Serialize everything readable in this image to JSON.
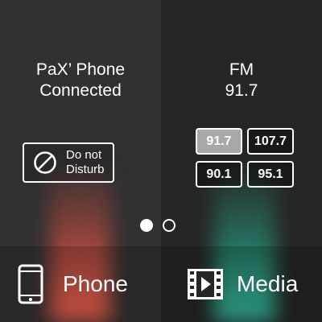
{
  "phone_panel": {
    "device_name": "PaX’ Phone",
    "connection_status": "Connected",
    "dnd_button": {
      "line1": "Do not",
      "line2": "Disturb",
      "icon": "do-not-disturb-icon"
    },
    "accent_color": "#ff6450"
  },
  "radio_panel": {
    "band": "FM",
    "frequency": "91.7",
    "presets": [
      {
        "label": "91.7",
        "active": true
      },
      {
        "label": "107.7",
        "active": false
      },
      {
        "label": "90.1",
        "active": false
      },
      {
        "label": "95.1",
        "active": false
      }
    ],
    "accent_color": "#32c8a5"
  },
  "page_indicator": {
    "count": 2,
    "current": 1
  },
  "bottom_nav": {
    "phone": {
      "label": "Phone",
      "icon": "smartphone-icon"
    },
    "media": {
      "label": "Media",
      "icon": "film-play-icon"
    }
  }
}
